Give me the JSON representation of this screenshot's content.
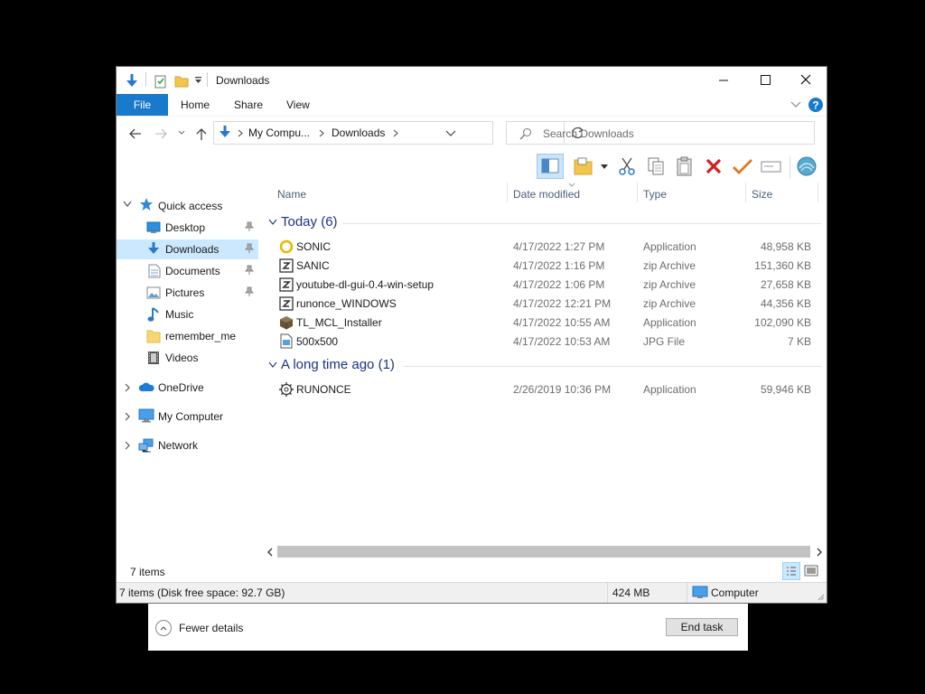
{
  "taskmgr": {
    "fewer_details": "Fewer details",
    "end_task": "End task"
  },
  "window": {
    "title": "Downloads",
    "tabs": {
      "file": "File",
      "home": "Home",
      "share": "Share",
      "view": "View"
    },
    "address": {
      "root": "My Compu...",
      "current": "Downloads"
    },
    "search_placeholder": "Search Downloads",
    "accent_color": "#1979ca"
  },
  "nav": {
    "quick_access": "Quick access",
    "items": [
      {
        "label": "Desktop",
        "icon": "desktop-icon",
        "pinned": true
      },
      {
        "label": "Downloads",
        "icon": "download-icon",
        "pinned": true,
        "selected": true
      },
      {
        "label": "Documents",
        "icon": "documents-icon",
        "pinned": true
      },
      {
        "label": "Pictures",
        "icon": "pictures-icon",
        "pinned": true
      },
      {
        "label": "Music",
        "icon": "music-icon",
        "pinned": false
      },
      {
        "label": "remember_me",
        "icon": "folder-icon",
        "pinned": false
      },
      {
        "label": "Videos",
        "icon": "videos-icon",
        "pinned": false
      }
    ],
    "onedrive": "OneDrive",
    "my_computer": "My Computer",
    "network": "Network"
  },
  "columns": {
    "name": "Name",
    "date": "Date modified",
    "type": "Type",
    "size": "Size"
  },
  "groups": [
    {
      "label": "Today (6)",
      "files": [
        {
          "name": "SONIC",
          "date": "4/17/2022 1:27 PM",
          "type": "Application",
          "size": "48,958 KB",
          "icon": "app-ring-icon"
        },
        {
          "name": "SANIC",
          "date": "4/17/2022 1:16 PM",
          "type": "zip Archive",
          "size": "151,360 KB",
          "icon": "zip-icon"
        },
        {
          "name": "youtube-dl-gui-0.4-win-setup",
          "date": "4/17/2022 1:06 PM",
          "type": "zip Archive",
          "size": "27,658 KB",
          "icon": "zip-icon"
        },
        {
          "name": "runonce_WINDOWS",
          "date": "4/17/2022 12:21 PM",
          "type": "zip Archive",
          "size": "44,356 KB",
          "icon": "zip-icon"
        },
        {
          "name": "TL_MCL_Installer",
          "date": "4/17/2022 10:55 AM",
          "type": "Application",
          "size": "102,090 KB",
          "icon": "block-app-icon"
        },
        {
          "name": "500x500",
          "date": "4/17/2022 10:53 AM",
          "type": "JPG File",
          "size": "7 KB",
          "icon": "image-file-icon"
        }
      ]
    },
    {
      "label": "A long time ago (1)",
      "files": [
        {
          "name": "RUNONCE",
          "date": "2/26/2019 10:36 PM",
          "type": "Application",
          "size": "59,946 KB",
          "icon": "app-gear-icon"
        }
      ]
    }
  ],
  "status": {
    "items": "7 items"
  },
  "taskbar": {
    "disk": "7 items (Disk free space: 92.7 GB)",
    "size": "424 MB",
    "location": "Computer"
  }
}
